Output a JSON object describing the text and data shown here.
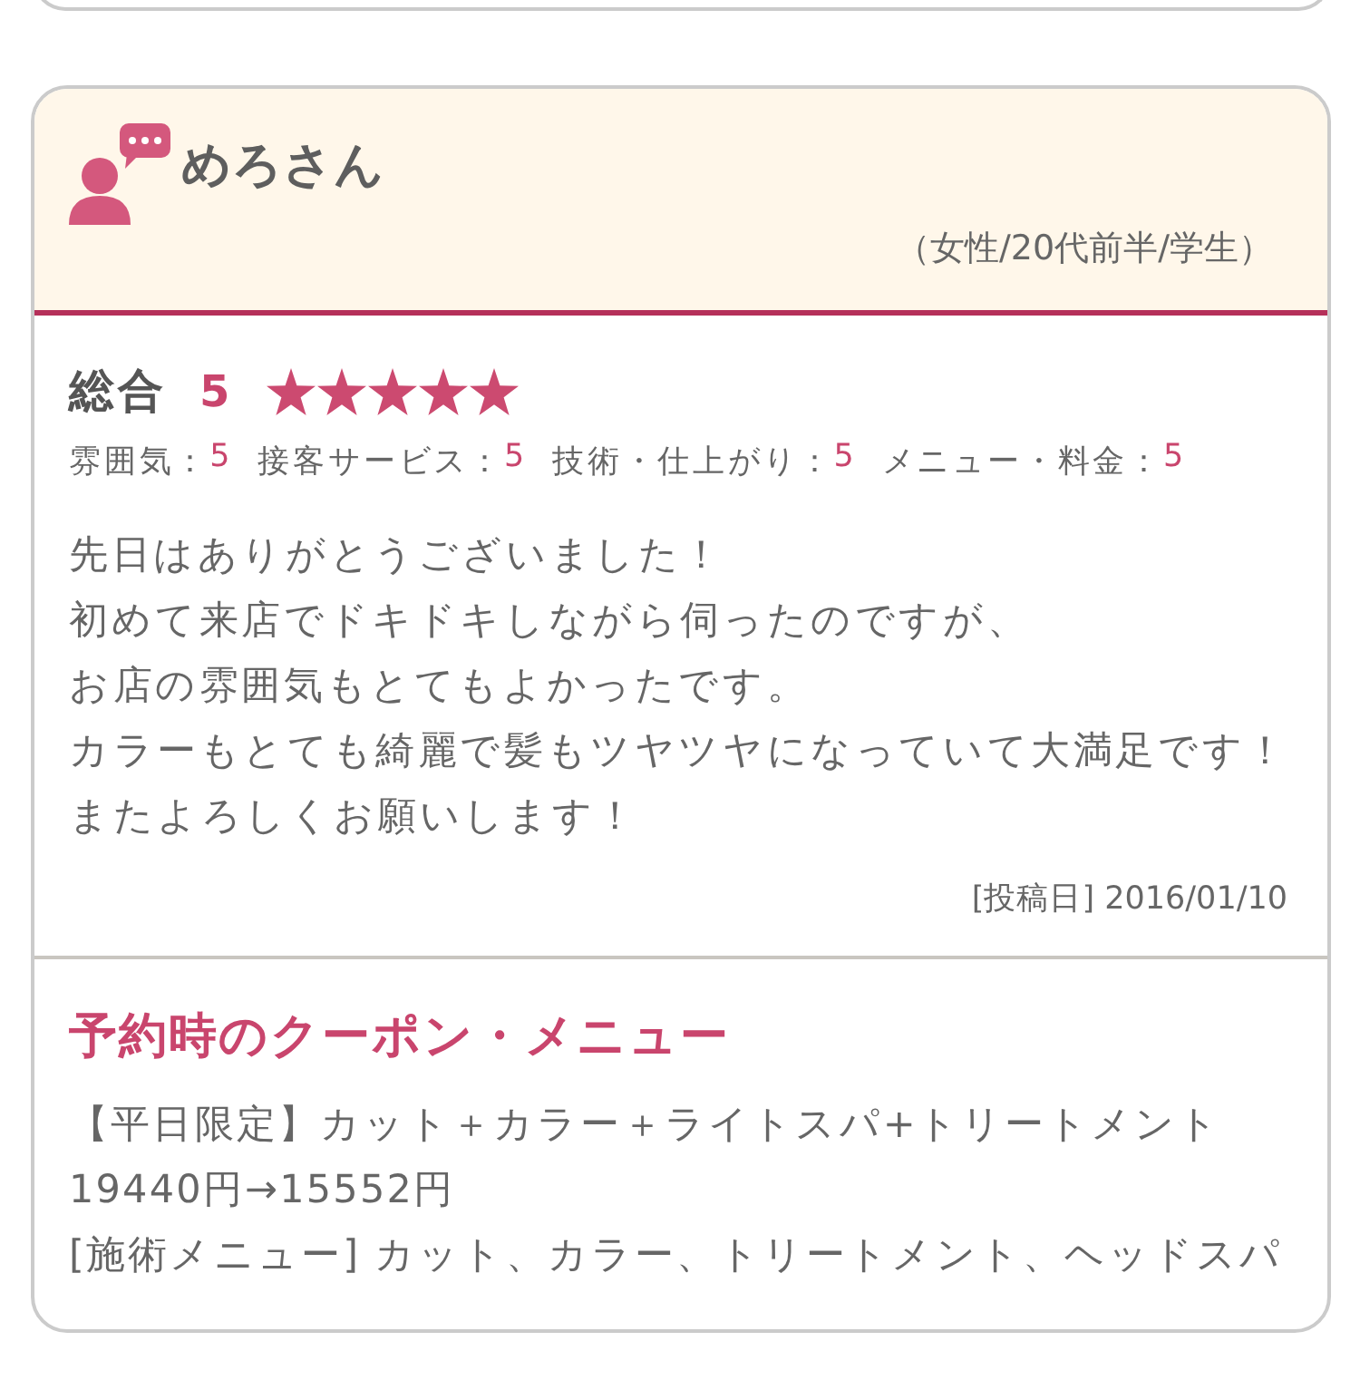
{
  "review": {
    "reviewer": {
      "name": "めろさん",
      "profile": "（女性/20代前半/学生）"
    },
    "overall": {
      "label": "総合",
      "score": "5",
      "stars": 5
    },
    "sub_ratings": [
      {
        "label": "雰囲気：",
        "score": "5"
      },
      {
        "label": "接客サービス：",
        "score": "5"
      },
      {
        "label": "技術・仕上がり：",
        "score": "5"
      },
      {
        "label": "メニュー・料金：",
        "score": "5"
      }
    ],
    "body": [
      "先日はありがとうございました！",
      "初めて来店でドキドキしながら伺ったのですが、",
      "お店の雰囲気もとてもよかったです。",
      "カラーもとても綺麗で髪もツヤツヤになっていて大満足です！",
      "またよろしくお願いします！"
    ],
    "posted": "[投稿日] 2016/01/10",
    "coupon": {
      "title": "予約時のクーポン・メニュー",
      "lines": [
        "【平日限定】カット＋カラー＋ライトスパ+トリートメント",
        "19440円→15552円",
        "[施術メニュー] カット、カラー、トリートメント、ヘッドスパ"
      ]
    }
  }
}
